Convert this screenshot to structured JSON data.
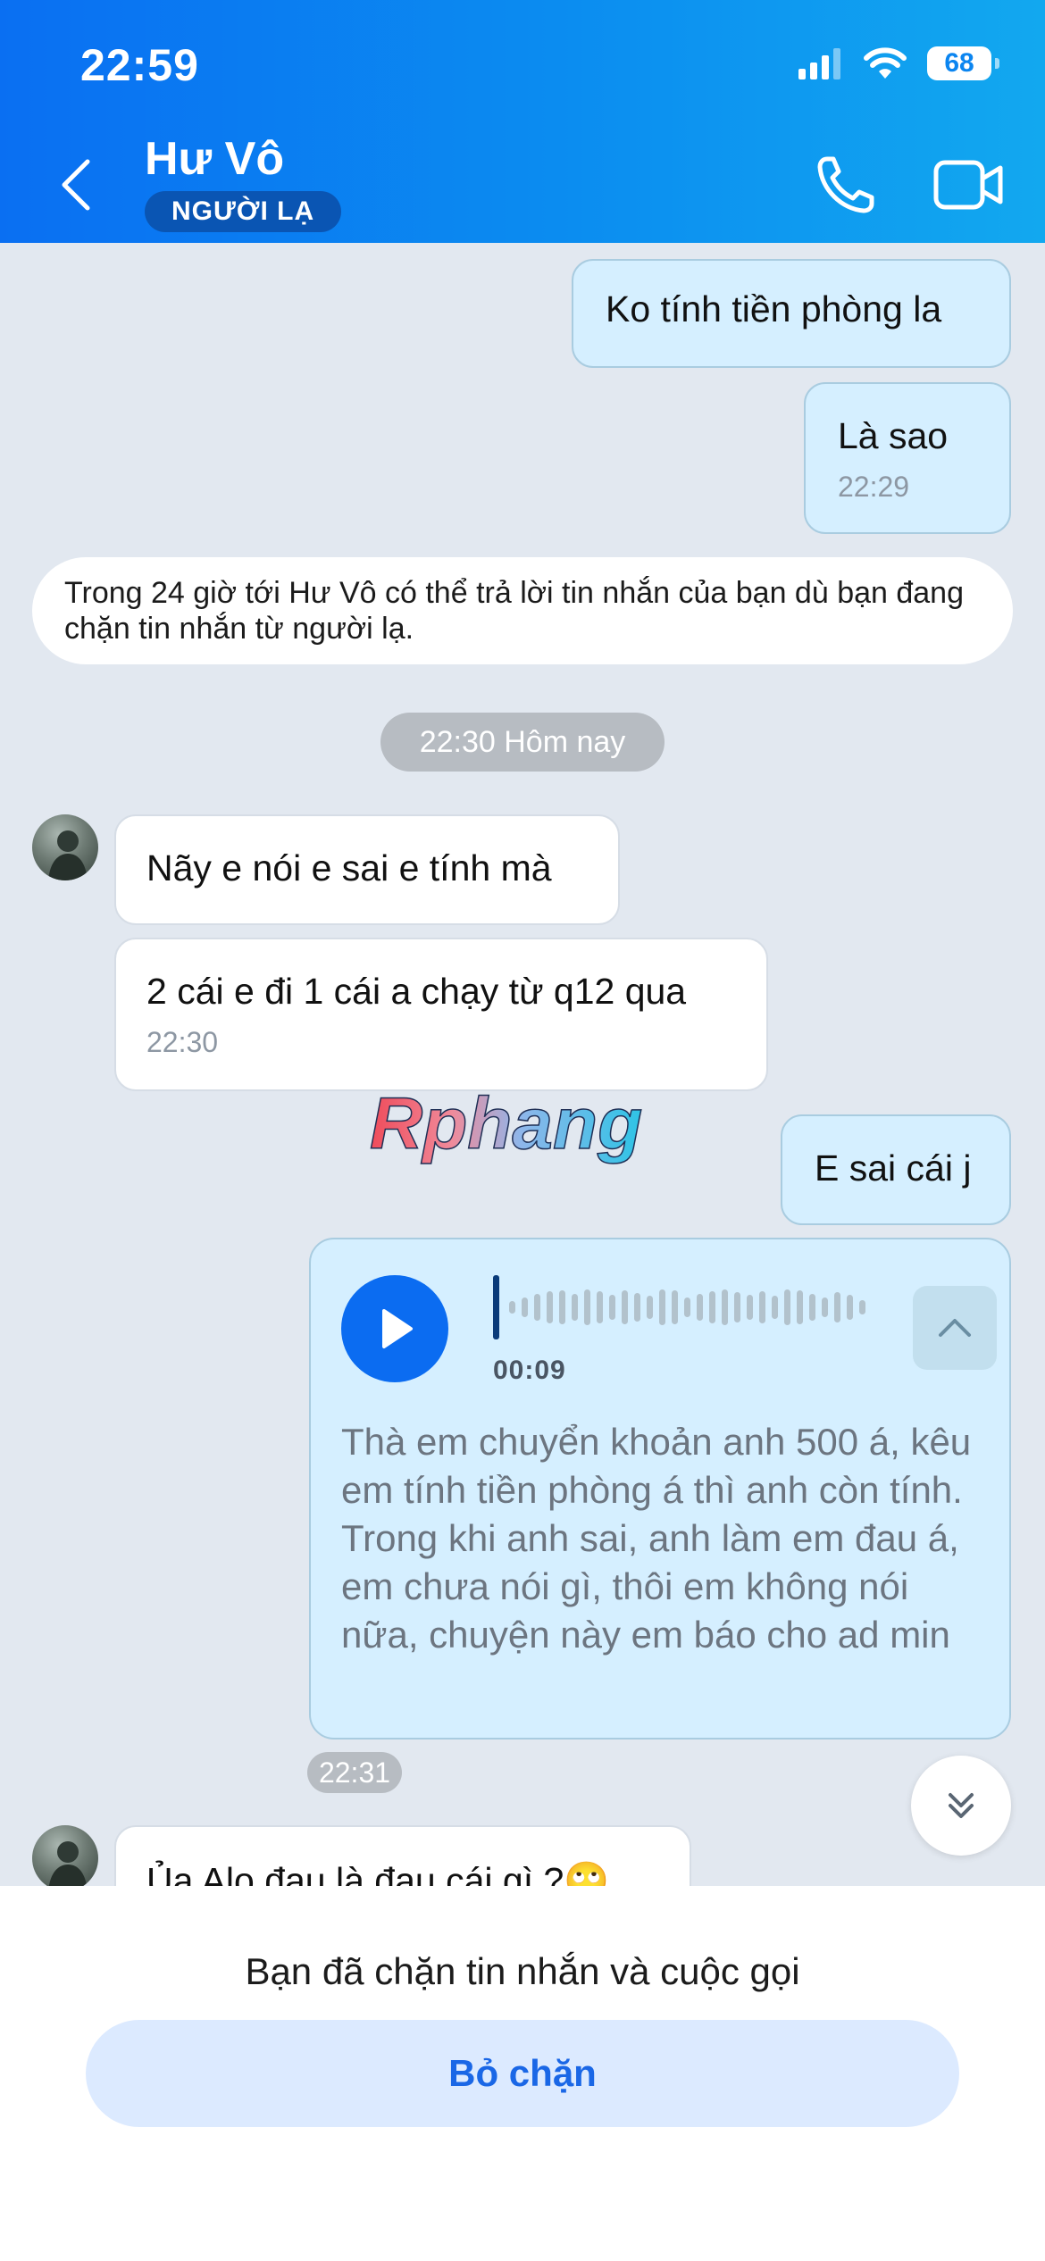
{
  "status_bar": {
    "time": "22:59",
    "battery": "68"
  },
  "header": {
    "title": "Hư Vô",
    "badge": "NGƯỜI LẠ"
  },
  "messages": {
    "m1": {
      "text": "Ko tính tiền phòng la"
    },
    "m2": {
      "text": "Là sao",
      "time": "22:29"
    },
    "notice": "Trong 24 giờ tới Hư Vô có thể trả lời tin nhắn của bạn dù bạn đang chặn tin nhắn từ người lạ.",
    "date_separator": "22:30 Hôm nay",
    "m3": {
      "text": "Nãy e nói e sai e tính mà"
    },
    "m4": {
      "text": "2 cái e đi 1 cái a chạy từ q12 qua",
      "time": "22:30"
    },
    "m5": {
      "text": "E sai cái j"
    },
    "voice": {
      "duration": "00:09",
      "transcript": "Thà em chuyển khoản anh 500 á, kêu em tính tiền phòng á thì anh còn tính. Trong khi anh sai, anh làm em đau á, em chưa nói gì, thôi em không nói nữa, chuyện này em báo cho ad min",
      "time": "22:31",
      "progress": 0
    },
    "m6": {
      "text": "Ủa Alo đau là đau cái gì ?🙄"
    }
  },
  "watermark": "Rphang",
  "bottom": {
    "blocked_text": "Bạn đã chặn tin nhắn và cuộc gọi",
    "unblock_label": "Bỏ chặn"
  },
  "colors": {
    "header": "#0b85f0",
    "outgoing_bubble": "#d5efff",
    "incoming_bubble": "#ffffff",
    "chat_bg": "#e2e8f0",
    "accent": "#0b6cf1"
  }
}
